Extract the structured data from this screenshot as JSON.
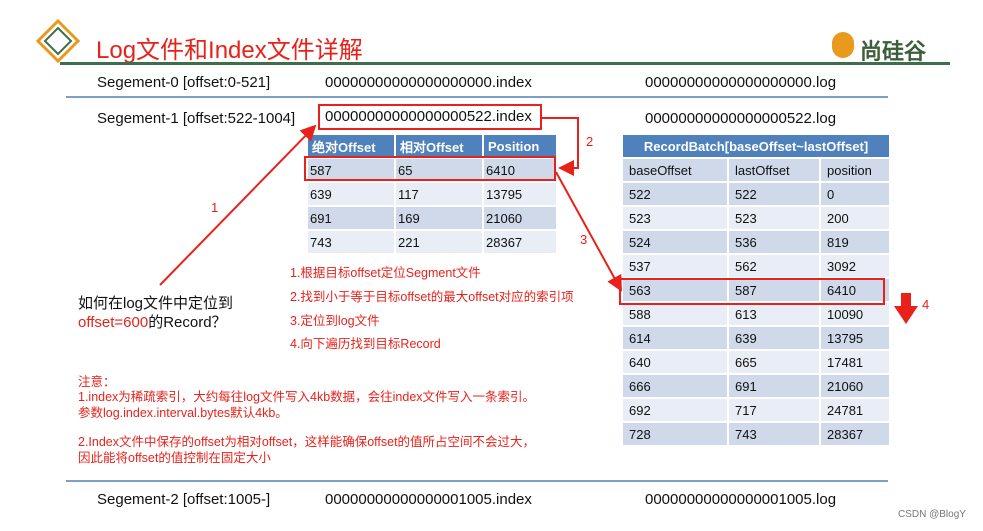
{
  "header": {
    "title": "Log文件和Index文件详解",
    "brand": "尚硅谷"
  },
  "segments": [
    {
      "label": "Segement-0 [offset:0-521]",
      "index": "00000000000000000000.index",
      "log": "00000000000000000000.log"
    },
    {
      "label": "Segement-1 [offset:522-1004]",
      "index": "00000000000000000522.index",
      "log": "00000000000000000522.log"
    },
    {
      "label": "Segement-2 [offset:1005-]",
      "index": "00000000000000001005.index",
      "log": "00000000000000001005.log"
    }
  ],
  "index_table": {
    "headers": [
      "绝对Offset",
      "相对Offset",
      "Position"
    ],
    "rows": [
      [
        "587",
        "65",
        "6410"
      ],
      [
        "639",
        "117",
        "13795"
      ],
      [
        "691",
        "169",
        "21060"
      ],
      [
        "743",
        "221",
        "28367"
      ]
    ]
  },
  "log_table": {
    "title": "RecordBatch[baseOffset~lastOffset]",
    "headers": [
      "baseOffset",
      "lastOffset",
      "position"
    ],
    "rows": [
      [
        "522",
        "522",
        "0"
      ],
      [
        "523",
        "523",
        "200"
      ],
      [
        "524",
        "536",
        "819"
      ],
      [
        "537",
        "562",
        "3092"
      ],
      [
        "563",
        "587",
        "6410"
      ],
      [
        "588",
        "613",
        "10090"
      ],
      [
        "614",
        "639",
        "13795"
      ],
      [
        "640",
        "665",
        "17481"
      ],
      [
        "666",
        "691",
        "21060"
      ],
      [
        "692",
        "717",
        "24781"
      ],
      [
        "728",
        "743",
        "28367"
      ]
    ]
  },
  "steps": [
    "1.根据目标offset定位Segment文件",
    "2.找到小于等于目标offset的最大offset对应的索引项",
    "3.定位到log文件",
    "4.向下遍历找到目标Record"
  ],
  "question": {
    "line1": "如何在log文件中定位到",
    "target": "offset=600",
    "suffix": "的Record？"
  },
  "notes": {
    "heading": "注意：",
    "n1a": "1.index为稀疏索引，大约每往log文件写入4kb数据，会往index文件写入一条索引。",
    "n1b": "参数log.index.interval.bytes默认4kb。",
    "n2a": "2.Index文件中保存的offset为相对offset，这样能确保offset的值所占空间不会过大，",
    "n2b": "因此能将offset的值控制在固定大小"
  },
  "arrow_labels": [
    "1",
    "2",
    "3",
    "4"
  ],
  "watermark": "CSDN @BlogY",
  "colors": {
    "red": "#e8221b",
    "blue": "#4f81bd",
    "green": "#3f6e4c"
  }
}
